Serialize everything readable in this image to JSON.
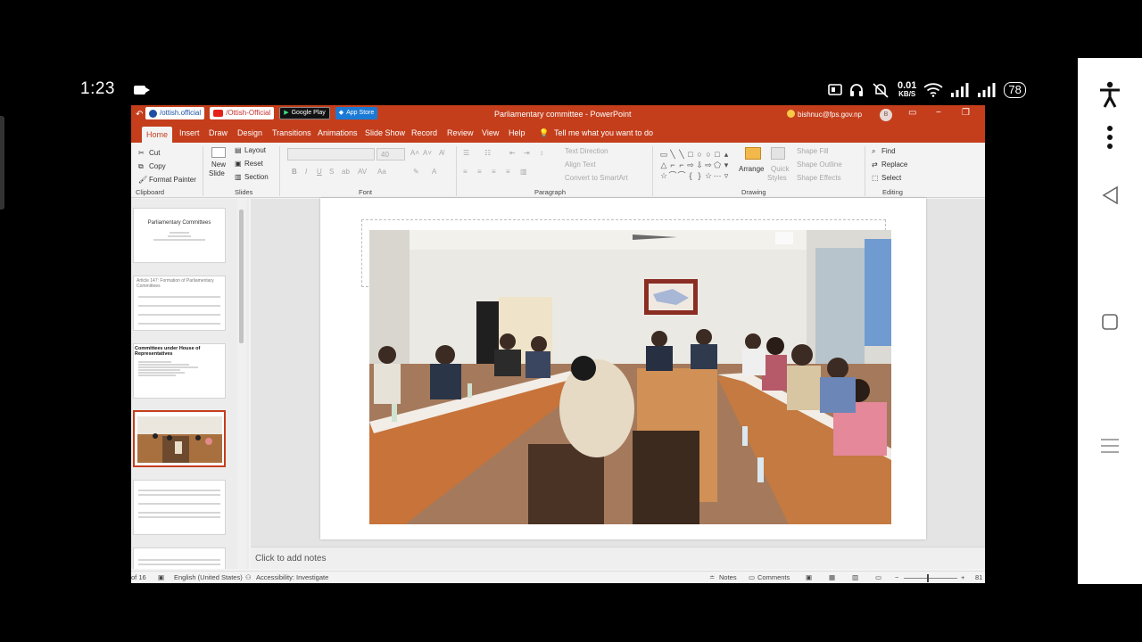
{
  "phone": {
    "time": "1:23",
    "net_speed_value": "0.01",
    "net_speed_unit": "KB/S",
    "battery": "78"
  },
  "window": {
    "title": "Parliamentary committee  -  PowerPoint",
    "user_email": "bishnuc@fps.gov.np",
    "avatar_initial": "B",
    "badges": {
      "facebook": "/ottish.official",
      "youtube": "/Ottish-Official",
      "google_play": "Google Play",
      "app_store": "App Store"
    }
  },
  "tabs": {
    "home": "Home",
    "items": [
      "Insert",
      "Draw",
      "Design",
      "Transitions",
      "Animations",
      "Slide Show",
      "Record",
      "Review",
      "View",
      "Help"
    ],
    "tell_me": "Tell me what you want to do"
  },
  "ribbon": {
    "clipboard": {
      "cut": "Cut",
      "copy": "Copy",
      "format_painter": "Format Painter",
      "label": "Clipboard"
    },
    "slides": {
      "new_slide_line1": "New",
      "new_slide_line2": "Slide",
      "layout": "Layout",
      "reset": "Reset",
      "section": "Section",
      "label": "Slides"
    },
    "font": {
      "size": "40",
      "label": "Font"
    },
    "paragraph": {
      "text_direction": "Text Direction",
      "align_text": "Align Text",
      "convert_smartart": "Convert to SmartArt",
      "label": "Paragraph"
    },
    "drawing": {
      "arrange": "Arrange",
      "quick_styles_line1": "Quick",
      "quick_styles_line2": "Styles",
      "shape_fill": "Shape Fill",
      "shape_outline": "Shape Outline",
      "shape_effects": "Shape Effects",
      "label": "Drawing"
    },
    "editing": {
      "find": "Find",
      "replace": "Replace",
      "select": "Select",
      "label": "Editing"
    }
  },
  "thumbnails": {
    "slide1_title": "Parliamentary Committees",
    "slide2_title": "Article 147: Formation of Parliamentary Committees",
    "slide3_title": "Committees under House of Representatives"
  },
  "notes": {
    "placeholder": "Click to add notes"
  },
  "statusbar": {
    "slide_count": "of 16",
    "language": "English (United States)",
    "accessibility": "Accessibility: Investigate",
    "notes": "Notes",
    "comments": "Comments",
    "zoom": "81"
  }
}
